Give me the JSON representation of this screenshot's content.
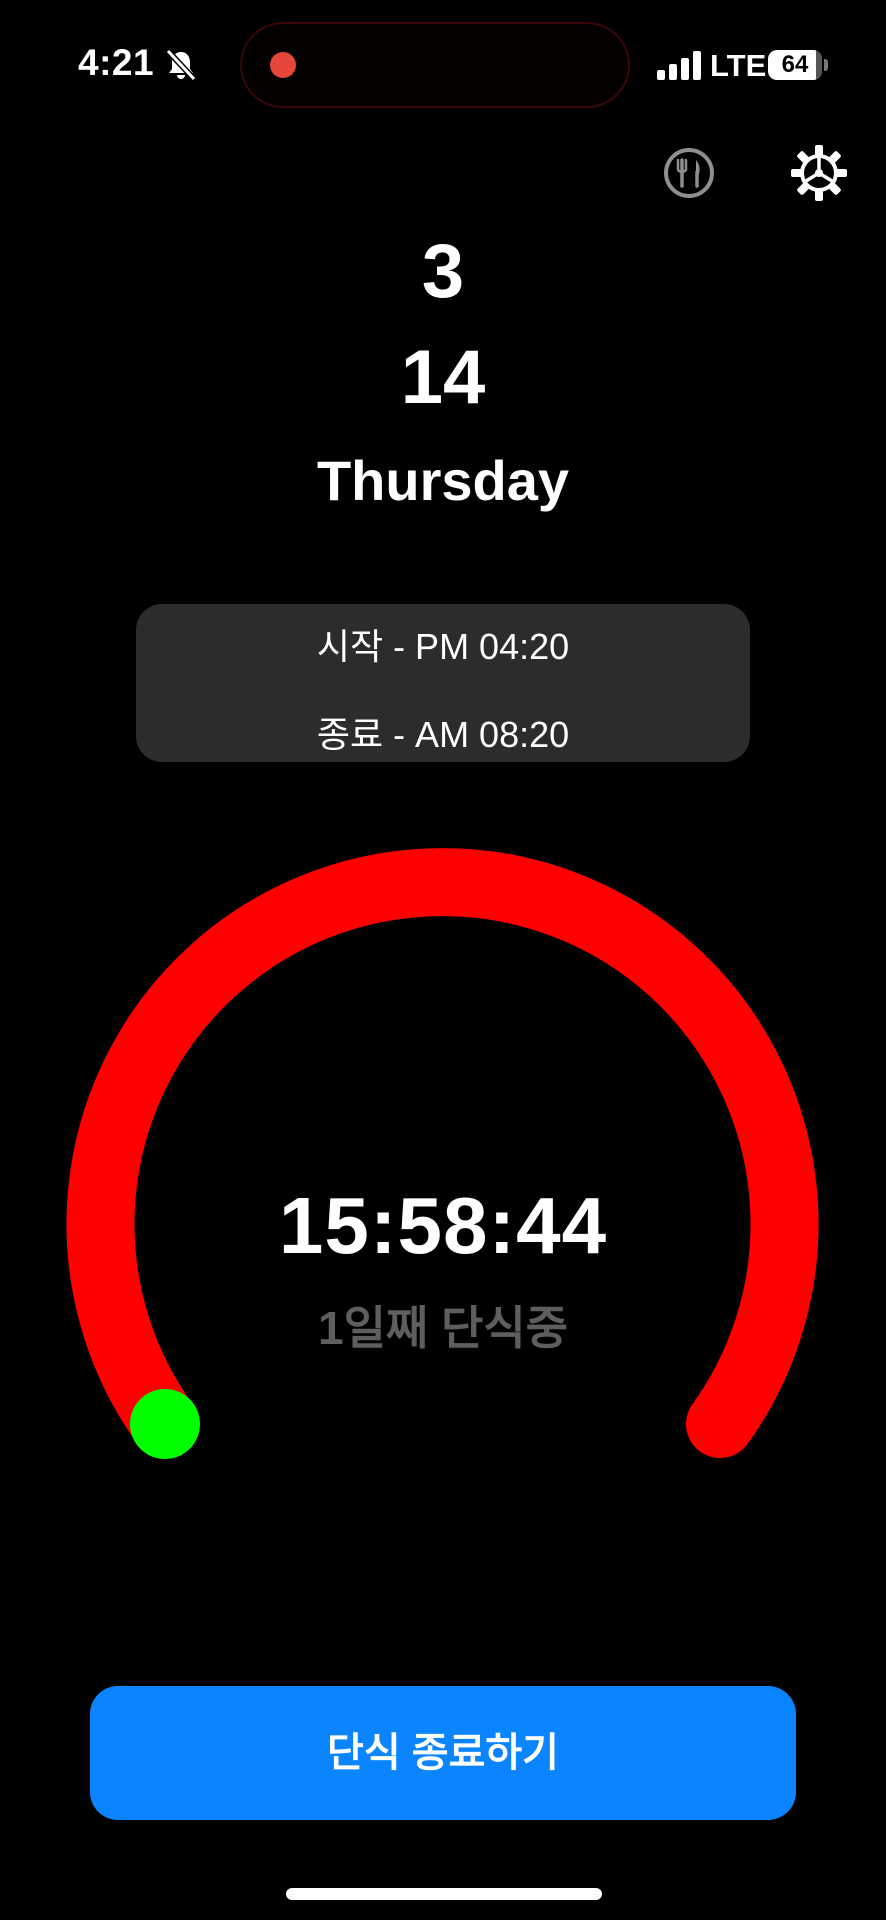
{
  "status_bar": {
    "time": "4:21",
    "network": "LTE",
    "battery": "64"
  },
  "date": {
    "month": "3",
    "day": "14",
    "weekday": "Thursday"
  },
  "schedule": {
    "start": "시작 - PM 04:20",
    "end": "종료 - AM 08:20"
  },
  "timer": {
    "elapsed": "15:58:44",
    "status": "1일째 단식중",
    "ring_color": "#ff0000",
    "progress_marker_color": "#00ff00"
  },
  "actions": {
    "end_fasting": "단식 종료하기"
  },
  "icons": [
    "mute-icon",
    "signal-icon",
    "fork-knife-icon",
    "gear-icon"
  ]
}
